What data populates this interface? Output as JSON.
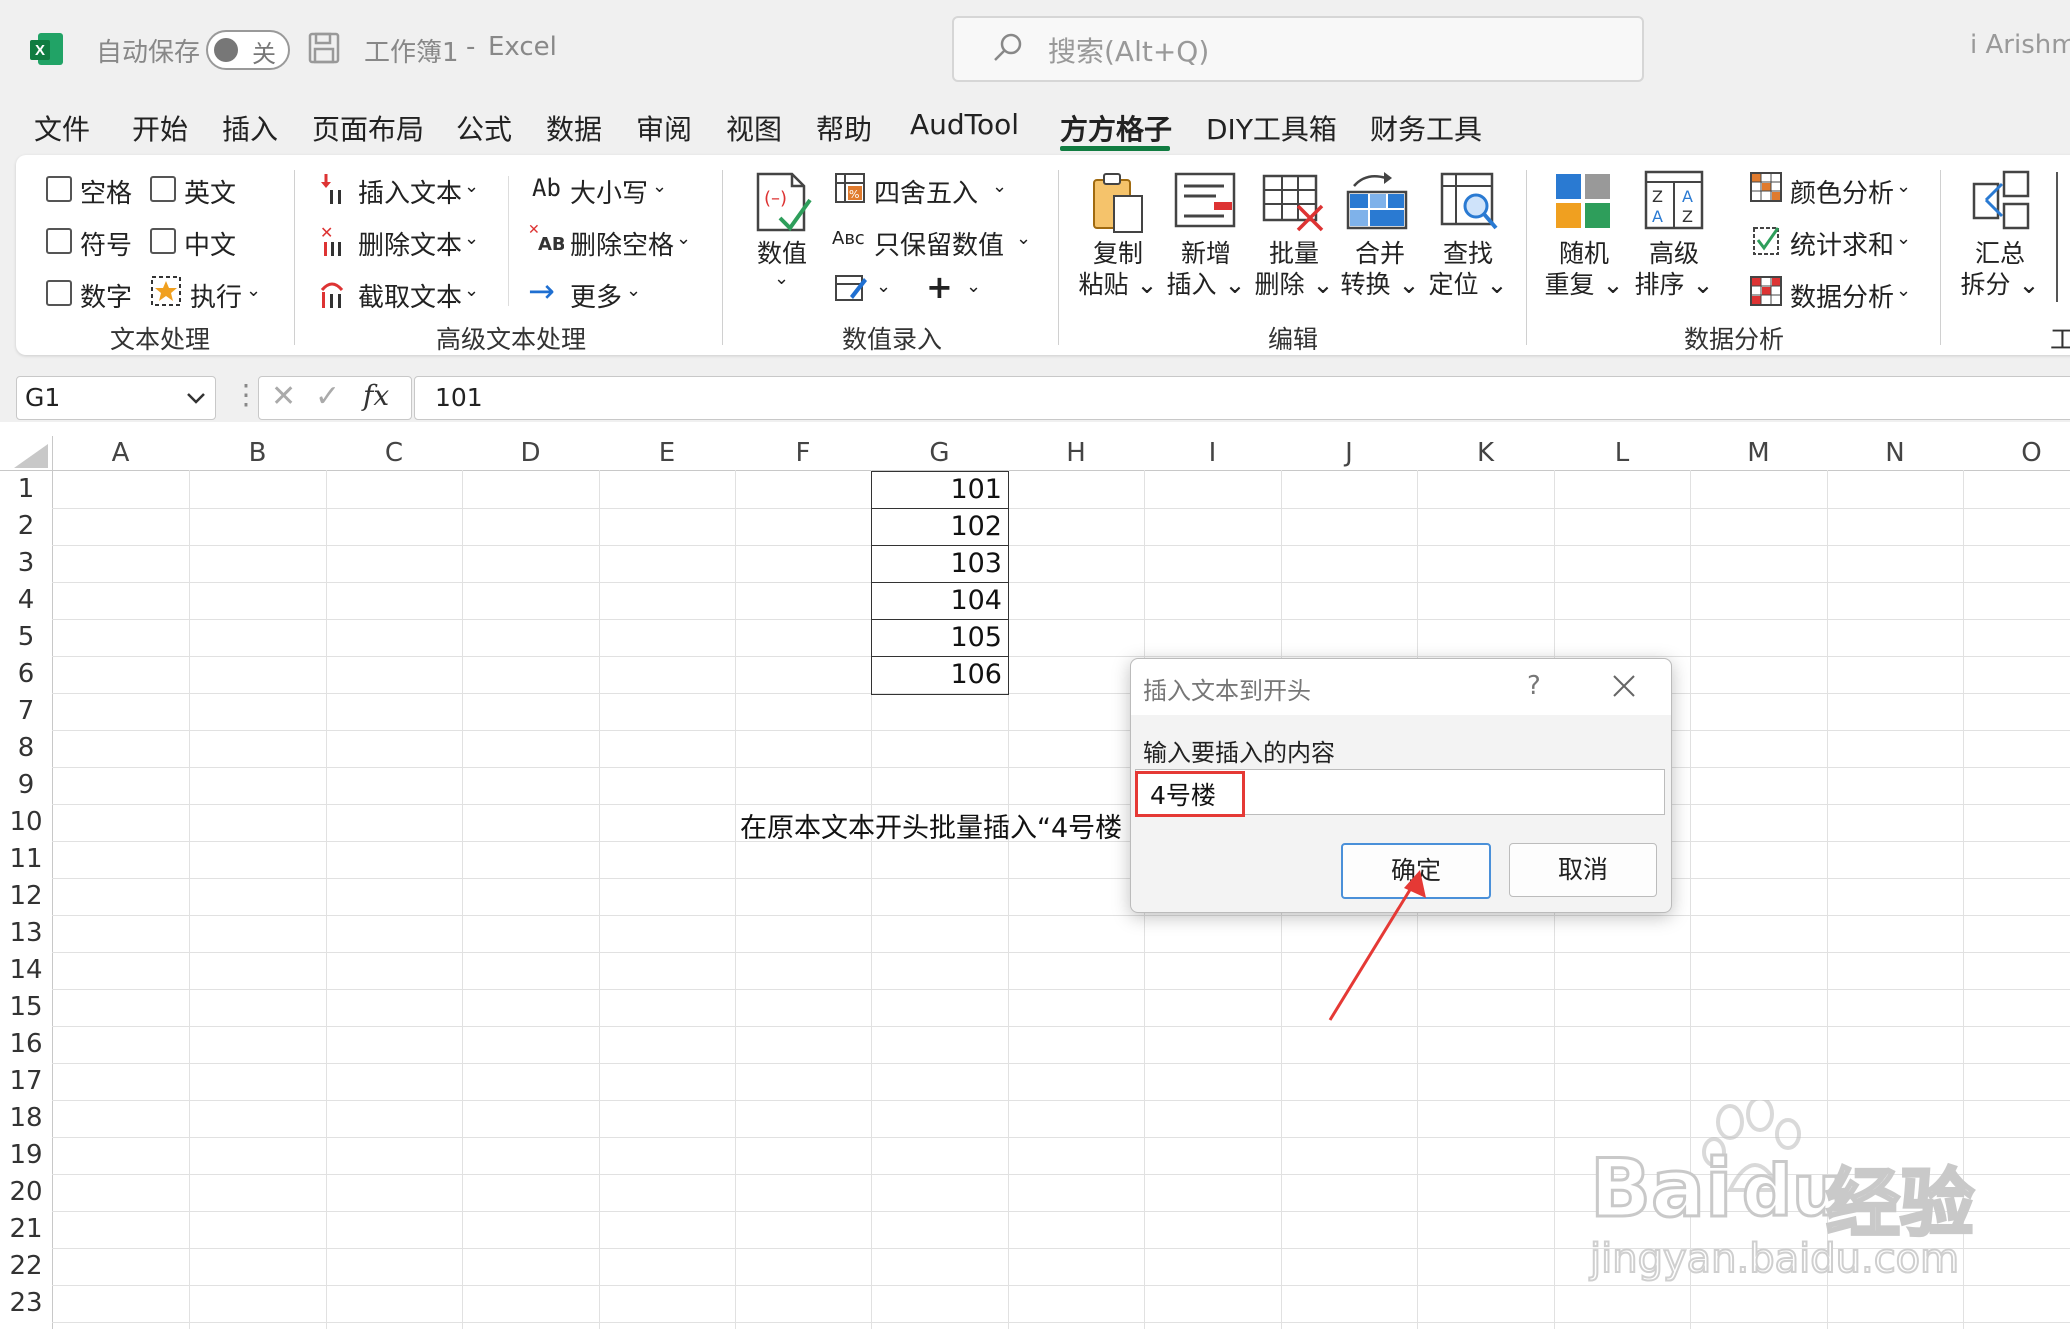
{
  "titlebar": {
    "autosave_label": "自动保存",
    "toggle_state": "关",
    "workbook_name": "工作簿1",
    "separator": "-",
    "app_name": "Excel",
    "search_placeholder": "搜索(Alt+Q)",
    "user_name": "i Arishmi"
  },
  "tabs": [
    "文件",
    "开始",
    "插入",
    "页面布局",
    "公式",
    "数据",
    "审阅",
    "视图",
    "帮助",
    "AudTool",
    "方方格子",
    "DIY工具箱",
    "财务工具"
  ],
  "active_tab": "方方格子",
  "ribbon": {
    "text_group": {
      "checkboxes": [
        "空格",
        "英文",
        "符号",
        "中文",
        "数字"
      ],
      "execute": "执行",
      "label": "文本处理"
    },
    "adv_group": {
      "items": [
        "插入文本",
        "删除文本",
        "截取文本",
        "大小写",
        "删除空格",
        "更多"
      ],
      "label": "高级文本处理"
    },
    "num_group": {
      "big": "数值",
      "items": [
        "四舍五入",
        "只保留数值"
      ],
      "label": "数值录入"
    },
    "edit_group": {
      "buttons": [
        "复制粘贴",
        "新增插入",
        "批量删除",
        "合并转换",
        "查找定位"
      ],
      "label": "编辑"
    },
    "analysis_group": {
      "buttons": [
        "随机重复",
        "高级排序"
      ],
      "items": [
        "颜色分析",
        "统计求和",
        "数据分析"
      ],
      "label": "数据分析"
    },
    "summary_group": {
      "button": "汇总拆分",
      "label_partial": "工"
    }
  },
  "formula_bar": {
    "name_box": "G1",
    "fx": "fx",
    "value": "101"
  },
  "columns": [
    "A",
    "B",
    "C",
    "D",
    "E",
    "F",
    "G",
    "H",
    "I",
    "J",
    "K",
    "L",
    "M",
    "N",
    "O"
  ],
  "rows": [
    "1",
    "2",
    "3",
    "4",
    "5",
    "6",
    "7",
    "8",
    "9",
    "10",
    "11",
    "12",
    "13",
    "14",
    "15",
    "16",
    "17",
    "18",
    "19",
    "20",
    "21",
    "22",
    "23"
  ],
  "cells": {
    "G": [
      "101",
      "102",
      "103",
      "104",
      "105",
      "106"
    ],
    "note": "在原本文本开头批量插入“4号楼"
  },
  "dialog": {
    "title": "插入文本到开头",
    "help": "?",
    "prompt": "输入要插入的内容",
    "input_value": "4号楼",
    "ok": "确定",
    "cancel": "取消"
  },
  "watermark": {
    "brand": "Bai",
    "brand2": "du",
    "suffix": "经验",
    "url": "jingyan.baidu.com"
  },
  "colors": {
    "excel_green": "#107c41",
    "annotation_red": "#e53935",
    "active_tab_underline": "#107c41"
  }
}
